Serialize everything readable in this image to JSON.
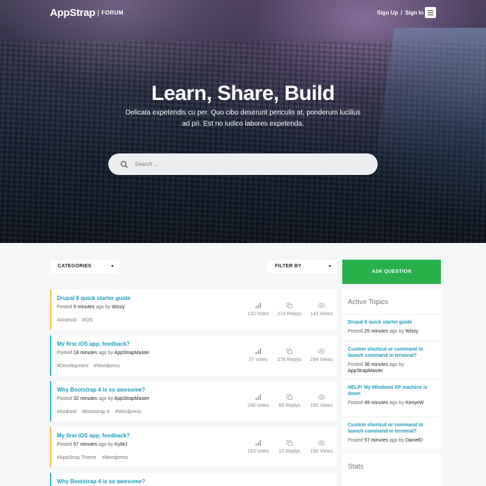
{
  "brand": {
    "name": "AppStrap",
    "sub": "FORUM"
  },
  "auth": {
    "signup": "Sign Up",
    "separator": "/",
    "signin": "Sign In"
  },
  "hero": {
    "title": "Learn, Share, Build",
    "subtitle": "Delicata expetendis cu per. Quo cibo deserunt periculis at, ponderum lucilius ad pri. Est no iudico labores expetenda.",
    "search_placeholder": "Search ..."
  },
  "filters": {
    "categories": "CATEGORIES",
    "filter_by": "FILTER BY"
  },
  "ask_button": "ASK QUESTION",
  "posts": [
    {
      "title": "Drupal 8 quick starter guide",
      "posted": "Posted",
      "time": "9 minutes",
      "ago": "ago by",
      "author": "Wizzy",
      "tags": [
        "#Android",
        "#iOS"
      ],
      "votes": "132 Votes",
      "replys": "214 Replys",
      "views": "143 Views",
      "accent": "#f0c24b"
    },
    {
      "title": "My first iOS app, feedback?",
      "posted": "Posted",
      "time": "18 minutes",
      "ago": "ago by",
      "author": "AppStrapMaster",
      "tags": [
        "#Development",
        "#Wordpress"
      ],
      "votes": "27 Votes",
      "replys": "278 Replys",
      "views": "294 Views",
      "accent": "#3bb6c5"
    },
    {
      "title": "Why Bootstrap 4 is so awesome?",
      "posted": "Posted",
      "time": "32 minutes",
      "ago": "ago by",
      "author": "AppStrapMaster",
      "tags": [
        "#Android",
        "#Bootstrap 4",
        "#Wordpress"
      ],
      "votes": "246 Votes",
      "replys": "86 Replys",
      "views": "195 Views",
      "accent": "#3bb6c5"
    },
    {
      "title": "My first iOS app, feedback?",
      "posted": "Posted",
      "time": "57 minutes",
      "ago": "ago by",
      "author": "KylieJ",
      "tags": [
        "#AppStrap Theme",
        "#Wordpress"
      ],
      "votes": "163 Votes",
      "replys": "15 Replys",
      "views": "196 Views",
      "accent": "#f0c24b"
    },
    {
      "title": "Why Bootstrap 4 is so awesome?",
      "accent": "#3bb6c5"
    }
  ],
  "active_topics": {
    "heading": "Active Topics",
    "items": [
      {
        "title": "Drupal 8 quick starter guide",
        "posted": "Posted",
        "time": "25 minutes",
        "ago": "ago by",
        "author": "Wizzy"
      },
      {
        "title": "Custom shortcut or command to launch command in terminal?",
        "posted": "Posted",
        "time": "36 minutes",
        "ago": "ago by",
        "author": "AppStrapMaster"
      },
      {
        "title": "HELP! My Windows XP machine is down",
        "posted": "Posted",
        "time": "49 minutes",
        "ago": "ago by",
        "author": "KenyeW"
      },
      {
        "title": "Custom shortcut or command to launch command in terminal?",
        "posted": "Posted",
        "time": "57 minutes",
        "ago": "ago by",
        "author": "DanielD"
      }
    ]
  },
  "stats": {
    "heading": "Stats"
  },
  "icons": {
    "search": "search-icon",
    "menu": "menu-icon",
    "votes": "bar-chart-icon",
    "replys": "copy-icon",
    "views": "eye-icon",
    "caret": "caret-down-icon"
  }
}
